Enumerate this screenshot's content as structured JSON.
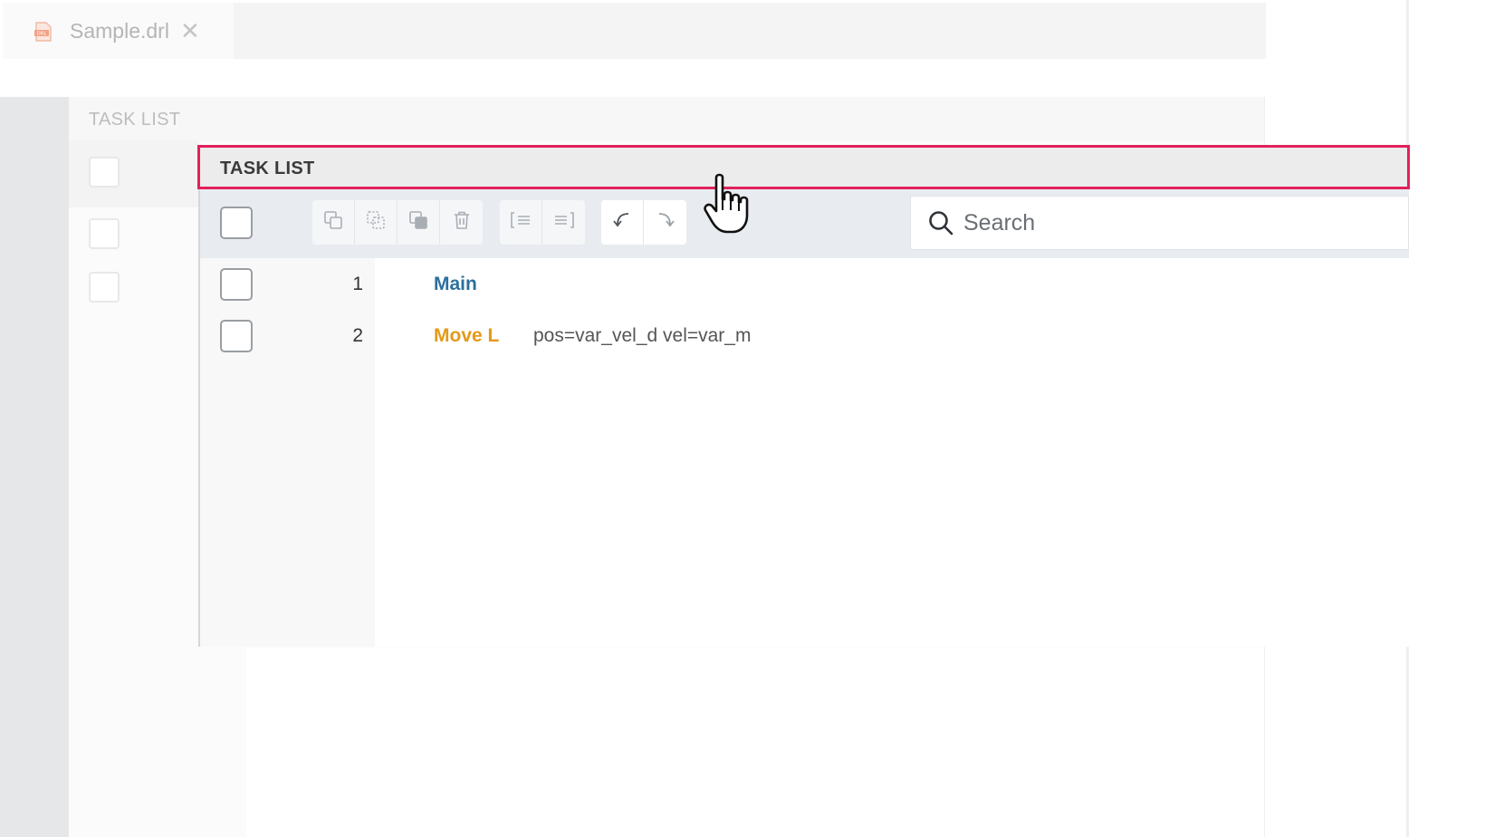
{
  "background_window": {
    "tab": {
      "file_name": "Sample.drl",
      "file_icon": "drl-file-icon",
      "close_icon": "close-icon",
      "close_glyph": "✕"
    },
    "panel_title": "TASK LIST"
  },
  "task_list": {
    "title": "TASK LIST",
    "toolbar": {
      "edit_icons": [
        "copy-icon",
        "cut-icon",
        "paste-icon",
        "delete-icon"
      ],
      "indent_icons": [
        "outdent-icon",
        "indent-icon"
      ],
      "history_icons": [
        "undo-icon",
        "redo-icon"
      ]
    },
    "search": {
      "placeholder": "Search",
      "value": ""
    },
    "rows": [
      {
        "num": "1",
        "command": "Main",
        "args": "",
        "color": "#2b6f9f"
      },
      {
        "num": "2",
        "command": "Move L",
        "args": "pos=var_vel_d vel=var_m",
        "color": "#e39a19"
      }
    ]
  },
  "highlight_color": "#e2215a",
  "cursor": "hand-pointer-icon"
}
